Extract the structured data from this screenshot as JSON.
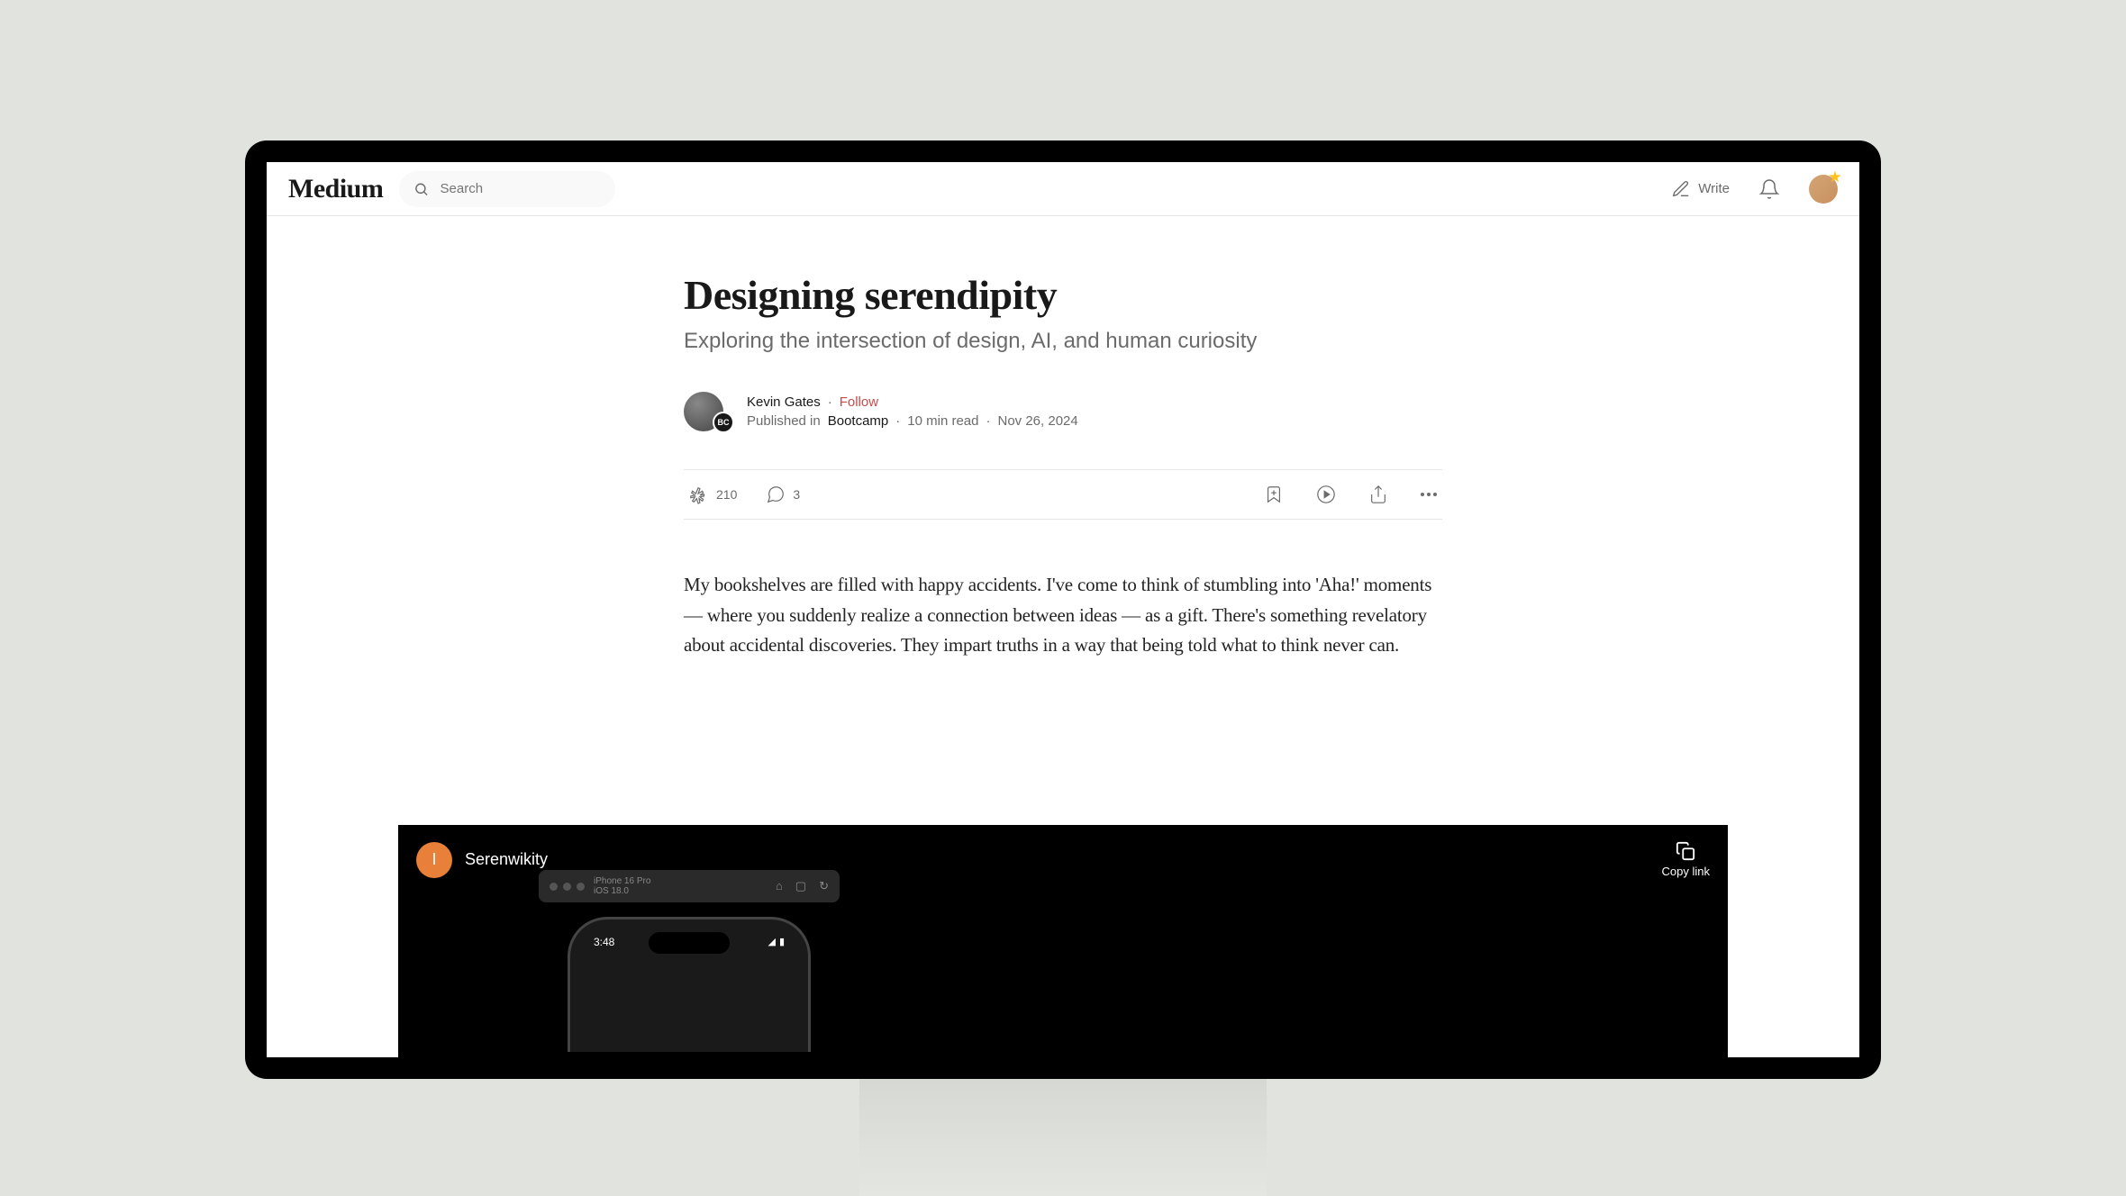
{
  "header": {
    "logo": "Medium",
    "search_placeholder": "Search",
    "write_label": "Write"
  },
  "article": {
    "title": "Designing serendipity",
    "subtitle": "Exploring the intersection of design, AI, and human curiosity",
    "author": "Kevin Gates",
    "follow": "Follow",
    "published_in_prefix": "Published in",
    "publication": "Bootcamp",
    "read_time": "10 min read",
    "date": "Nov 26, 2024",
    "claps": "210",
    "comments": "3",
    "body_p1": "My bookshelves are filled with happy accidents. I've come to think of stumbling into 'Aha!' moments — where you suddenly realize a connection between ideas — as a gift. There's something revelatory about accidental discoveries. They impart truths in a way that being told what to think never can."
  },
  "video": {
    "channel_initial": "I",
    "title": "Serenwikity",
    "copy_link": "Copy link",
    "sim_device": "iPhone 16 Pro",
    "sim_os": "iOS 18.0",
    "phone_time": "3:48"
  },
  "pub_badge": "BC"
}
